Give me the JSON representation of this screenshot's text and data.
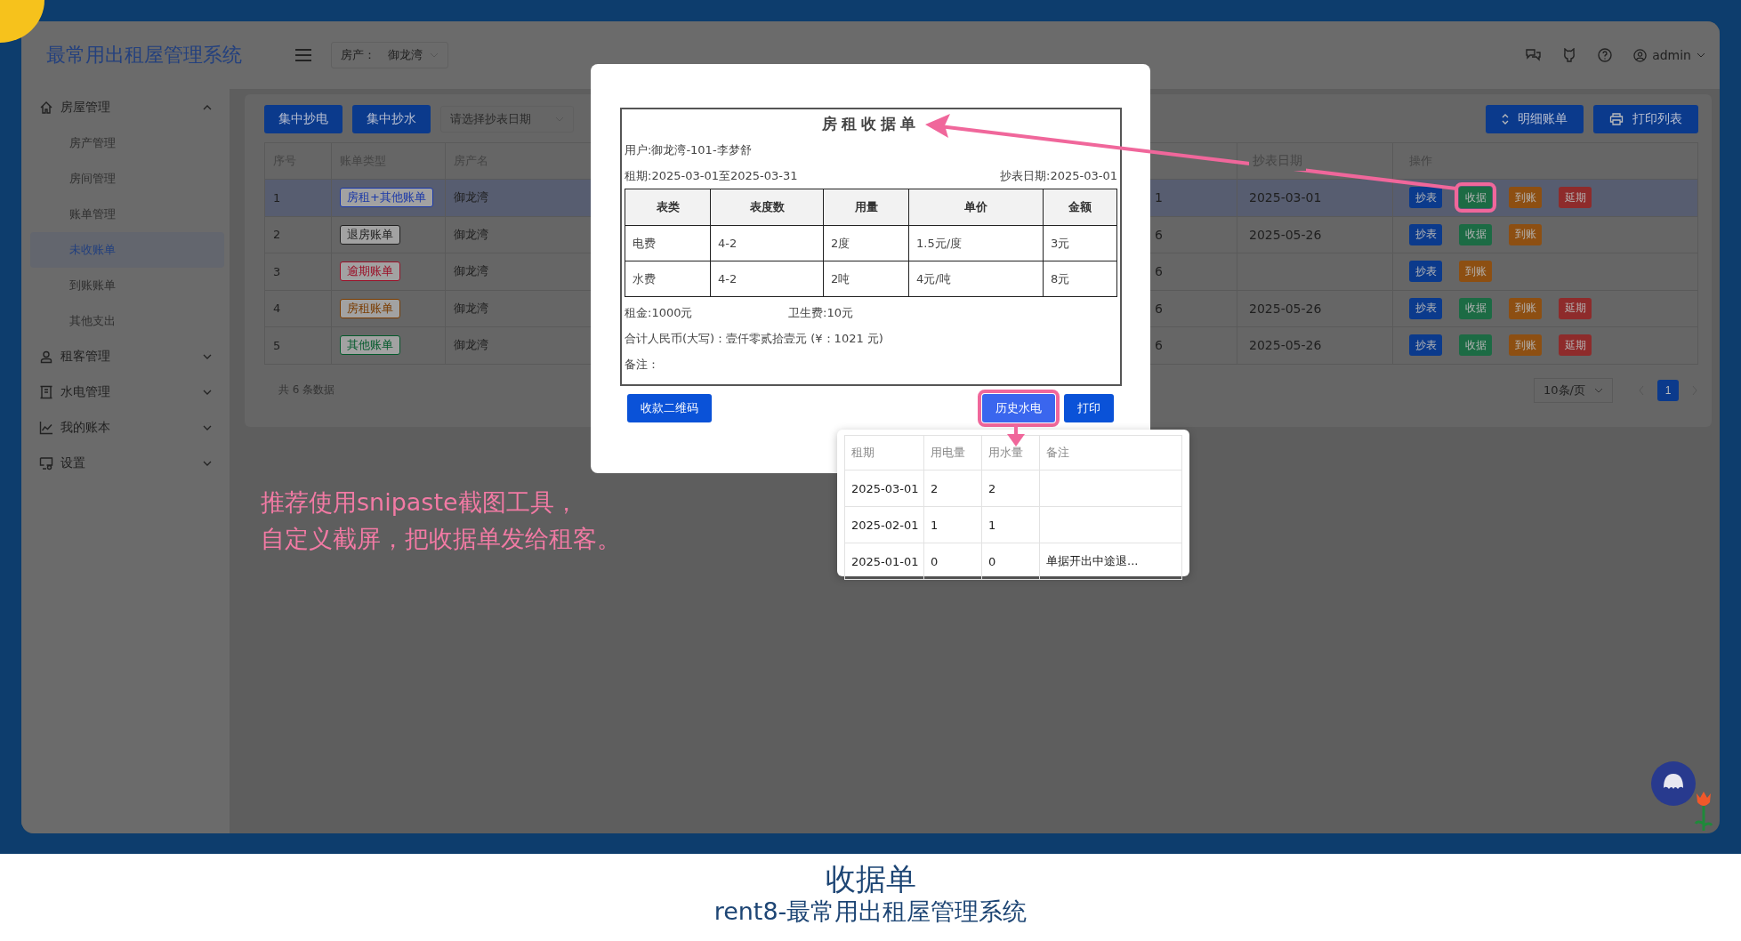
{
  "header": {
    "title": "最常用出租屋管理系统",
    "property_select": {
      "label": "房产：",
      "value": "御龙湾"
    },
    "user": "admin"
  },
  "sidebar": {
    "items": [
      {
        "label": "房屋管理",
        "expanded": true,
        "children": [
          {
            "label": "房产管理",
            "selected": false
          },
          {
            "label": "房间管理",
            "selected": false
          },
          {
            "label": "账单管理",
            "selected": false
          },
          {
            "label": "未收账单",
            "selected": true
          },
          {
            "label": "到账账单",
            "selected": false
          },
          {
            "label": "其他支出",
            "selected": false
          }
        ]
      },
      {
        "label": "租客管理",
        "expanded": false
      },
      {
        "label": "水电管理",
        "expanded": false
      },
      {
        "label": "我的账本",
        "expanded": false
      },
      {
        "label": "设置",
        "expanded": false
      }
    ]
  },
  "toolbar": {
    "buttons": [
      "集中抄电",
      "集中抄水"
    ],
    "date_select": {
      "placeholder": "请选择抄表日期"
    },
    "right_buttons": [
      "明细账单",
      "打印列表"
    ]
  },
  "table": {
    "columns": {
      "index": "序号",
      "bill_type": "账单类型",
      "property": "房产名",
      "read_date": "抄表日期",
      "actions": "操作"
    },
    "rows": [
      {
        "index": "1",
        "bill_type": {
          "label": "房租+其他账单",
          "color": "#1a38a8"
        },
        "property": "御龙湾",
        "column_4": "1",
        "read_date": "2025-03-01",
        "selected": true,
        "actions": [
          {
            "label": "抄表",
            "kind": "read",
            "annotated": false
          },
          {
            "label": "收据",
            "kind": "receipt",
            "annotated": true
          },
          {
            "label": "到账",
            "kind": "paid",
            "annotated": false
          },
          {
            "label": "延期",
            "kind": "delay",
            "annotated": false
          }
        ]
      },
      {
        "index": "2",
        "bill_type": {
          "label": "退房账单",
          "color": "#1f1f1f"
        },
        "property": "御龙湾",
        "column_4": "6",
        "read_date": "2025-05-26",
        "selected": false,
        "actions": [
          {
            "label": "抄表",
            "kind": "read",
            "annotated": false
          },
          {
            "label": "收据",
            "kind": "receipt",
            "annotated": false
          },
          {
            "label": "到账",
            "kind": "paid",
            "annotated": false
          }
        ]
      },
      {
        "index": "3",
        "bill_type": {
          "label": "逾期账单",
          "color": "#9a1028"
        },
        "property": "御龙湾",
        "column_4": "6",
        "selected": false,
        "actions": [
          {
            "label": "抄表",
            "kind": "read",
            "annotated": false
          },
          {
            "label": "到账",
            "kind": "paid",
            "annotated": false
          }
        ]
      },
      {
        "index": "4",
        "bill_type": {
          "label": "房租账单",
          "color": "#7a3c00"
        },
        "property": "御龙湾",
        "column_4": "6",
        "read_date": "2025-05-26",
        "selected": false,
        "actions": [
          {
            "label": "抄表",
            "kind": "read",
            "annotated": false
          },
          {
            "label": "收据",
            "kind": "receipt",
            "annotated": false
          },
          {
            "label": "到账",
            "kind": "paid",
            "annotated": false
          },
          {
            "label": "延期",
            "kind": "delay",
            "annotated": false
          }
        ]
      },
      {
        "index": "5",
        "bill_type": {
          "label": "其他账单",
          "color": "#045a2c"
        },
        "property": "御龙湾",
        "column_4": "6",
        "read_date": "2025-05-26",
        "selected": false,
        "actions": [
          {
            "label": "抄表",
            "kind": "read",
            "annotated": false
          },
          {
            "label": "收据",
            "kind": "receipt",
            "annotated": false
          },
          {
            "label": "到账",
            "kind": "paid",
            "annotated": false
          },
          {
            "label": "延期",
            "kind": "delay",
            "annotated": false
          }
        ]
      }
    ]
  },
  "footer": {
    "total": "共 6 条数据",
    "page_size": "10条/页",
    "pages": [
      {
        "label": "1",
        "selected": true
      }
    ]
  },
  "modal": {
    "receipt": {
      "title": "房租收据单",
      "user": "用户:御龙湾-101-李梦舒",
      "period": "租期:2025-03-01至2025-03-31",
      "read_date": "抄表日期:2025-03-01",
      "columns": [
        "表类",
        "表度数",
        "用量",
        "单价",
        "金额"
      ],
      "rows": [
        [
          "电费",
          "4-2",
          "2度",
          "1.5元/度",
          "3元"
        ],
        [
          "水费",
          "4-2",
          "2吨",
          "4元/吨",
          "8元"
        ]
      ],
      "rent": "租金:1000元",
      "sanitation": "卫生费:10元",
      "total": "合计人民币(大写)：壹仟零贰拾壹元 (¥：1021 元)",
      "remark": "备注："
    },
    "left_buttons": [
      {
        "label": "收款二维码",
        "annotated": false
      }
    ],
    "right_buttons": [
      {
        "label": "历史水电",
        "annotated": true
      },
      {
        "label": "打印",
        "annotated": false
      }
    ]
  },
  "history": {
    "columns": [
      "租期",
      "用电量",
      "用水量",
      "备注"
    ],
    "rows": [
      {
        "period": "2025-03-01",
        "electricity": "2",
        "water": "2"
      },
      {
        "period": "2025-02-01",
        "electricity": "1",
        "water": "1"
      },
      {
        "period": "2025-01-01",
        "electricity": "0",
        "water": "0",
        "remark": "单据开出中途退..."
      }
    ]
  },
  "note": [
    "推荐使用snipaste截图工具，",
    "自定义截屏，把收据单发给租客。"
  ],
  "caption": {
    "title": "收据单",
    "subtitle": "rent8-最常用出租屋管理系统"
  }
}
